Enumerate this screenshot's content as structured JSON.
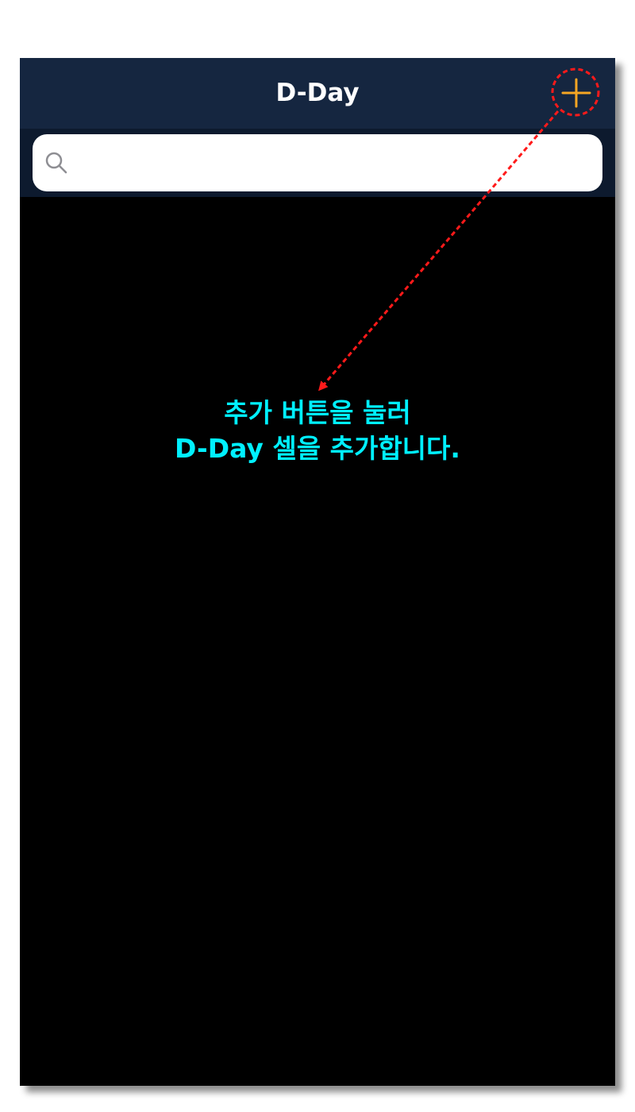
{
  "navbar": {
    "title": "D-Day",
    "add_icon": "plus-icon",
    "accent_color": "#f5a623",
    "background_color": "#152640"
  },
  "search": {
    "icon": "search-icon",
    "value": "",
    "placeholder": ""
  },
  "empty_state": {
    "line1": "추가 버튼을 눌러",
    "line2": "D-Day 셀을 추가합니다.",
    "color": "#00f0ff"
  },
  "annotation": {
    "color": "#ff1a1a"
  }
}
